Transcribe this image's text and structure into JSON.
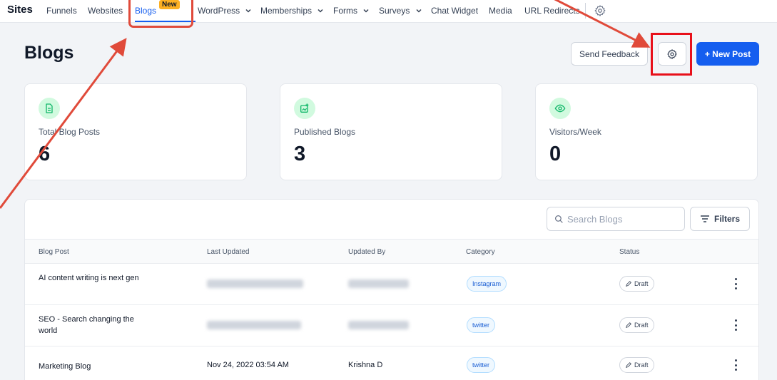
{
  "nav": {
    "brand": "Sites",
    "items": [
      {
        "label": "Funnels",
        "dropdown": false
      },
      {
        "label": "Websites",
        "dropdown": false
      },
      {
        "label": "Blogs",
        "dropdown": false,
        "active": true,
        "badge": "New"
      },
      {
        "label": "WordPress",
        "dropdown": true
      },
      {
        "label": "Memberships",
        "dropdown": true
      },
      {
        "label": "Forms",
        "dropdown": true
      },
      {
        "label": "Surveys",
        "dropdown": true
      },
      {
        "label": "Chat Widget",
        "dropdown": false
      },
      {
        "label": "Media",
        "dropdown": false
      },
      {
        "label": "URL Redirects",
        "dropdown": false
      }
    ],
    "settings_icon": "gear-icon"
  },
  "header": {
    "title": "Blogs",
    "feedback_label": "Send Feedback",
    "settings_icon": "gear-icon",
    "new_post_label": "+ New Post"
  },
  "stats": [
    {
      "label": "Total Blog Posts",
      "value": "6",
      "icon": "document-icon"
    },
    {
      "label": "Published Blogs",
      "value": "3",
      "icon": "published-blog-icon"
    },
    {
      "label": "Visitors/Week",
      "value": "0",
      "icon": "eye-icon"
    }
  ],
  "table": {
    "search_placeholder": "Search Blogs",
    "filters_label": "Filters",
    "columns": [
      "Blog Post",
      "Last Updated",
      "Updated By",
      "Category",
      "Status"
    ],
    "rows": [
      {
        "title": "AI content writing is next gen",
        "last_updated": "",
        "updated_by": "",
        "category": "Instagram",
        "status": "Draft"
      },
      {
        "title": "SEO - Search changing the world",
        "last_updated": "",
        "updated_by": "",
        "category": "twitter",
        "status": "Draft"
      },
      {
        "title": "Marketing Blog",
        "last_updated": "Nov 24, 2022 03:54 AM",
        "updated_by": "Krishna D",
        "category": "twitter",
        "status": "Draft"
      }
    ]
  },
  "colors": {
    "accent": "#155eef",
    "annotation": "#e04a3a",
    "badge_new": "#fdb022",
    "stat_icon_bg": "#d1fadf",
    "stat_icon_fg": "#12b76a"
  }
}
